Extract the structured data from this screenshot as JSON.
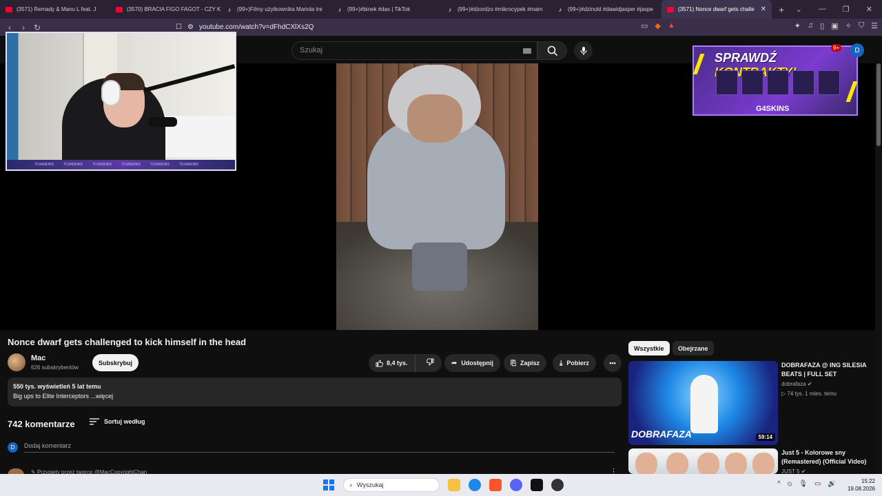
{
  "browser": {
    "tabs": [
      {
        "label": "(3571) Remady & Manu L feat. J",
        "type": "youtube",
        "active": false
      },
      {
        "label": "(3570) BRACIA FIGO FAGOT - CZY K",
        "type": "youtube",
        "active": false
      },
      {
        "label": "(99+)Filmy użytkownika Mariola tre",
        "type": "tiktok",
        "active": false
      },
      {
        "label": "(99+)#binek #das | TikTok",
        "type": "tiktok",
        "active": false
      },
      {
        "label": "(99+)#dzordzo #mikrocypek #mam",
        "type": "tiktok",
        "active": false
      },
      {
        "label": "(99+)#dzinold #dawidjasper #jaspe",
        "type": "tiktok",
        "active": false
      },
      {
        "label": "(3571) Nonce dwarf gets challe",
        "type": "youtube",
        "active": true
      }
    ],
    "url": "youtube.com/watch?v=dFhdCXlXs2Q",
    "badge_count": "6"
  },
  "youtube": {
    "search_placeholder": "Szukaj",
    "notif_count": "9+",
    "user_initial": "D",
    "video": {
      "title": "Nonce dwarf gets challenged to kick himself in the head",
      "channel": "Mac",
      "subscribers": "626 subskrybentów",
      "subscribe_label": "Subskrybuj",
      "likes": "8,4 tys.",
      "share_label": "Udostępnij",
      "save_label": "Zapisz",
      "download_label": "Pobierz",
      "views_meta": "550 tys. wyświetleń  5 lat temu",
      "description": "Big ups to Elite Interceptors ...więcej"
    },
    "comments": {
      "count": "742 komentarze",
      "sort_label": "Sortuj według",
      "add_placeholder": "Dodaj komentarz",
      "pinned_text": "Przypięty przez twórcę @MacCopyrightChan"
    },
    "sidebar": {
      "chips": [
        "Wszystkie",
        "Obejrzane"
      ],
      "recommendations": [
        {
          "title": "DOBRAFAZA @ ING SILESIA BEATS | FULL SET",
          "channel": "dobrafaza",
          "meta": "▷ 74 tys.  1 mies. temu",
          "duration": "59:14",
          "thumb_text": "DOBRAFAZA"
        },
        {
          "title": "Just 5 - Kolorowe sny (Remastered) (Official Video)",
          "channel": "JUST 5",
          "meta": "",
          "duration": ""
        }
      ]
    },
    "ad": {
      "title_white": "SPRAWDŹ ",
      "title_yellow": "KONTRAKTY!",
      "brand": "G4SKINS"
    }
  },
  "webcam": {
    "overlay_text": [
      "TOJADENIS",
      "TOJADENIS",
      "TOJADENIS",
      "TOJADENIS",
      "TOJADENIS",
      "TOJADENIS"
    ]
  },
  "taskbar": {
    "search_placeholder": "Wyszukaj",
    "time": "15:22",
    "date": "19.08.2026"
  }
}
